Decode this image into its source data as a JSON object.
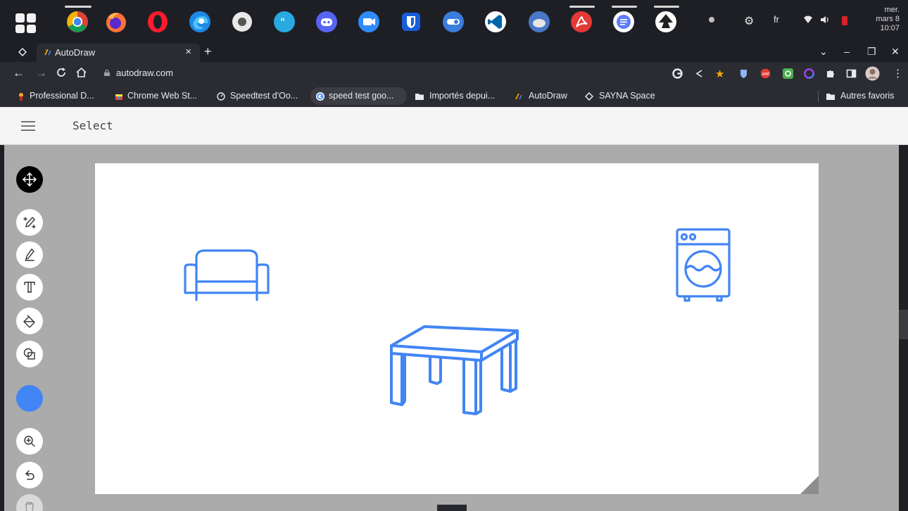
{
  "os": {
    "clock": {
      "day": "mer.",
      "date": "mars 8",
      "time": "10:07"
    },
    "language": "fr"
  },
  "browser": {
    "tab": {
      "title": "AutoDraw",
      "close_label": "×"
    },
    "new_tab_label": "+",
    "window_controls": {
      "dropdown": "⌄",
      "minimize": "–",
      "restore": "❐",
      "close": "✕"
    },
    "url": "autodraw.com",
    "bookmarks": [
      {
        "label": "Professional D..."
      },
      {
        "label": "Chrome Web St..."
      },
      {
        "label": "Speedtest d'Oo..."
      },
      {
        "label": "speed test goo..."
      },
      {
        "label": "Importés depui..."
      },
      {
        "label": "AutoDraw"
      },
      {
        "label": "SAYNA Space"
      }
    ],
    "other_bookmarks": "Autres favoris"
  },
  "app": {
    "mode_label": "Select",
    "tools": [
      {
        "name": "select-tool",
        "icon": "move-icon"
      },
      {
        "name": "autodraw-tool",
        "icon": "autodraw-icon"
      },
      {
        "name": "draw-tool",
        "icon": "pencil-icon"
      },
      {
        "name": "type-tool",
        "icon": "text-icon"
      },
      {
        "name": "fill-tool",
        "icon": "fill-bucket-icon"
      },
      {
        "name": "shape-tool",
        "icon": "shapes-icon"
      }
    ],
    "current_color": "#4285f4",
    "drawings": [
      "sofa",
      "washing-machine",
      "table"
    ]
  },
  "colors": {
    "accent": "#4285f4",
    "canvas": "#ffffff",
    "workspace": "#ababab"
  }
}
